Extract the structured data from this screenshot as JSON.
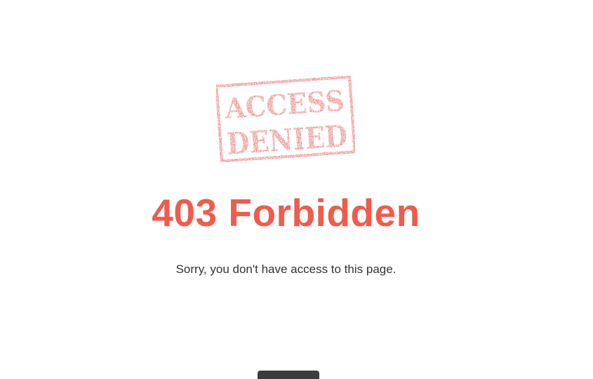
{
  "stamp": {
    "line1": "ACCESS",
    "line2": "DENIED",
    "color": "#e0433f"
  },
  "error": {
    "title": "403 Forbidden",
    "title_color": "#f05b4c",
    "message": "Sorry, you don't have access to this page."
  },
  "home_button": {
    "background": "#3c3c3c"
  }
}
